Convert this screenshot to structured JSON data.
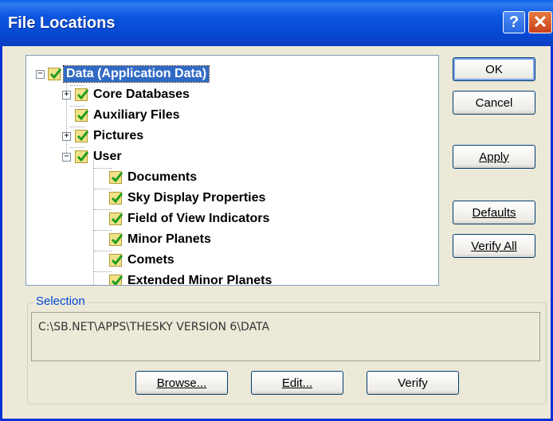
{
  "window": {
    "title": "File Locations",
    "help_label": "?",
    "close_label": "✕"
  },
  "tree": {
    "nodes": [
      {
        "label": "Data (Application Data)",
        "expander": "−",
        "selected": true
      },
      {
        "label": "Core Databases",
        "expander": "+"
      },
      {
        "label": "Auxiliary Files"
      },
      {
        "label": "Pictures",
        "expander": "+"
      },
      {
        "label": "User",
        "expander": "−"
      },
      {
        "label": "Documents"
      },
      {
        "label": "Sky Display Properties"
      },
      {
        "label": "Field of View Indicators"
      },
      {
        "label": "Minor Planets"
      },
      {
        "label": "Comets"
      },
      {
        "label": "Extended Minor Planets"
      }
    ]
  },
  "buttons": {
    "ok": "OK",
    "cancel": "Cancel",
    "apply": "Apply",
    "defaults": "Defaults",
    "verify_all": "Verify All",
    "browse": "Browse...",
    "edit": "Edit...",
    "verify": "Verify"
  },
  "selection": {
    "label": "Selection",
    "path": "C:\\SB.NET\\APPS\\THESKY VERSION 6\\DATA"
  },
  "colors": {
    "title_bar": "#0a55de",
    "selection_highlight": "#316ac5",
    "checkmark": "#1e9c1e"
  }
}
